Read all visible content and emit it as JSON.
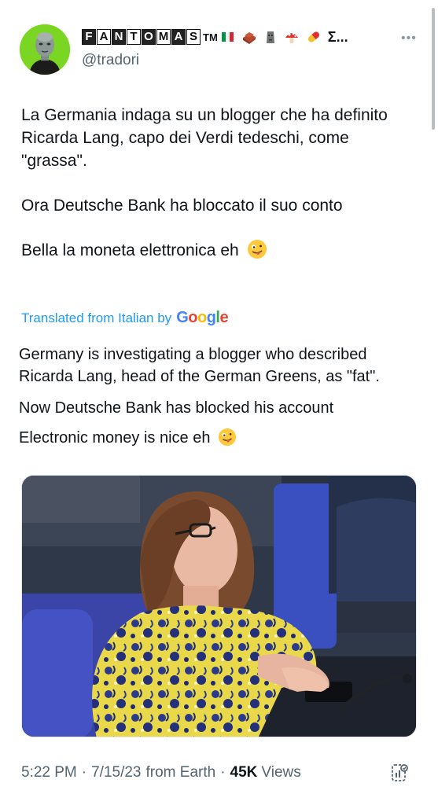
{
  "author": {
    "display_name_letters": [
      "F",
      "A",
      "N",
      "T",
      "O",
      "M",
      "A",
      "S"
    ],
    "trademark": "TM",
    "name_suffix": "Σ...",
    "handle": "@tradori",
    "emoji_icons": [
      "italy-flag-icon",
      "bricks-icon",
      "moai-icon",
      "mushroom-icon",
      "pill-icon"
    ]
  },
  "tweet": {
    "paragraph_1": "La Germania indaga su un blogger che ha definito Ricarda Lang, capo dei Verdi tedeschi, come \"grassa\".",
    "paragraph_2": "Ora Deutsche Bank ha bloccato il suo conto",
    "paragraph_3": "Bella la moneta elettronica eh"
  },
  "translation": {
    "label": "Translated from Italian by",
    "provider": "Google",
    "line_1": "Germany is investigating a blogger who described Ricarda Lang, head of the German Greens, as \"fat\".",
    "line_2": "Now Deutsche Bank has blocked his account",
    "line_3": "Electronic money is nice eh"
  },
  "meta": {
    "time": "5:22 PM",
    "date": "7/15/23",
    "source": "from Earth",
    "separator": "·",
    "views_count": "45K",
    "views_label": "Views"
  },
  "colors": {
    "link": "#1d9bf0",
    "secondary_text": "#536471",
    "primary_text": "#0f1419",
    "avatar_bg": "#7ad622"
  }
}
